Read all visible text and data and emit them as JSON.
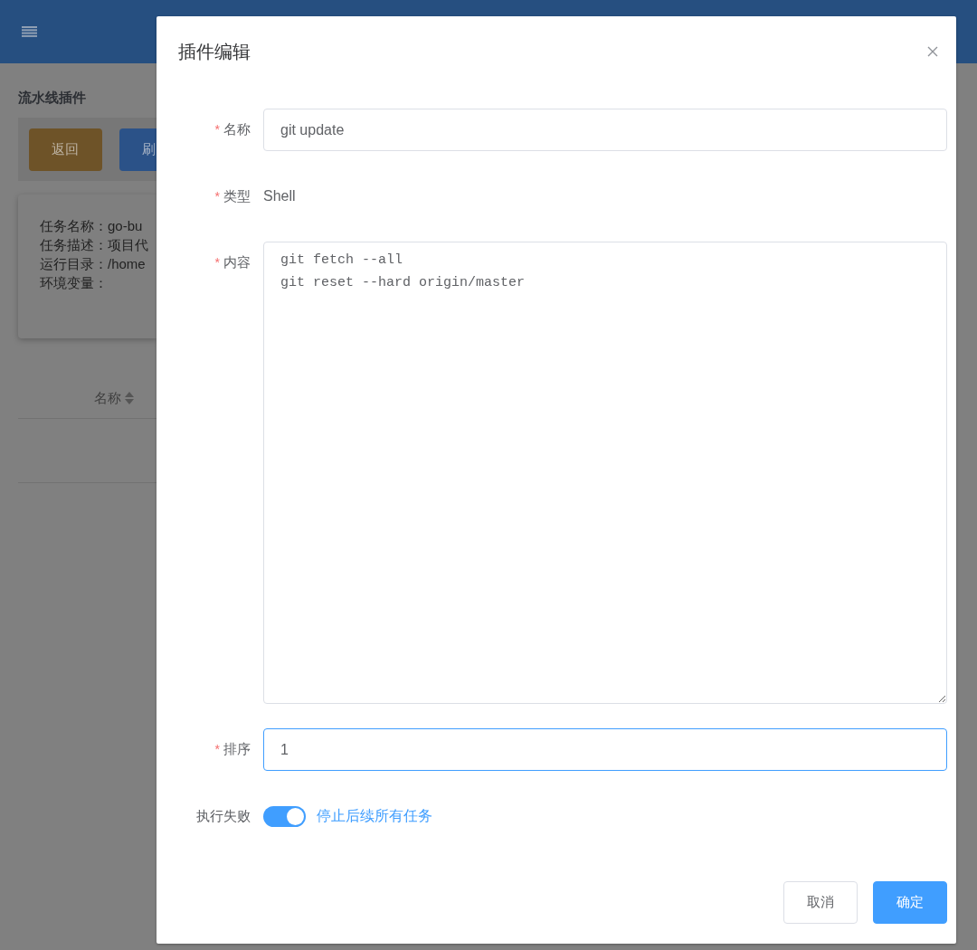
{
  "page": {
    "title": "流水线插件",
    "buttons": [
      {
        "label": "返回",
        "kind": "warning"
      },
      {
        "label": "刷",
        "kind": "primary"
      }
    ],
    "info": [
      "任务名称：go-bu",
      "任务描述：项目代",
      "运行目录：/home",
      "环境变量："
    ],
    "table": {
      "columns": [
        {
          "label": "名称",
          "sortable": true
        }
      ]
    }
  },
  "dialog": {
    "title": "插件编辑",
    "fields": [
      {
        "kind": "input",
        "required_mark": "*",
        "label": "名称",
        "value": "git update",
        "focused": false
      },
      {
        "kind": "text",
        "required_mark": "*",
        "label": "类型",
        "value": "Shell"
      },
      {
        "kind": "textarea",
        "required_mark": "*",
        "label": "内容",
        "value": "git fetch --all\ngit reset --hard origin/master"
      },
      {
        "kind": "input",
        "required_mark": "*",
        "label": "排序",
        "value": "1",
        "focused": true
      },
      {
        "kind": "switch",
        "label": "执行失败",
        "on": true,
        "text": "停止后续所有任务"
      }
    ],
    "buttons": [
      {
        "label": "取消",
        "kind": "default"
      },
      {
        "label": "确定",
        "kind": "primary"
      }
    ]
  }
}
